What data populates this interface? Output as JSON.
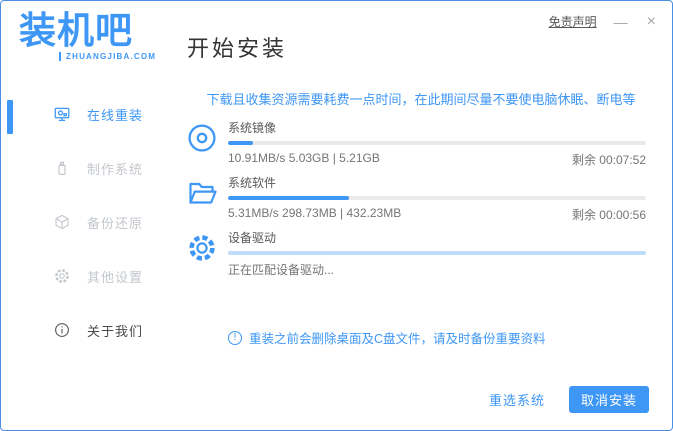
{
  "window": {
    "brand": "装机吧",
    "brand_domain": "ZHUANGJIBA.COM",
    "page_title": "开始安装",
    "disclaimer_link": "免责声明",
    "minimize_glyph": "—",
    "close_glyph": "×"
  },
  "sidebar": {
    "items": [
      {
        "label": "在线重装",
        "icon": "online-reinstall-monitor-icon",
        "state": "active"
      },
      {
        "label": "制作系统",
        "icon": "make-system-usb-icon",
        "state": "disabled"
      },
      {
        "label": "备份还原",
        "icon": "backup-restore-box-icon",
        "state": "disabled"
      },
      {
        "label": "其他设置",
        "icon": "other-settings-gear-icon",
        "state": "disabled"
      },
      {
        "label": "关于我们",
        "icon": "about-us-info-icon",
        "state": "normal"
      }
    ]
  },
  "main": {
    "top_notice": "下载且收集资源需要耗费一点时间，在此期间尽量不要使电脑休眠、断电等",
    "tasks": [
      {
        "icon": "disc-icon",
        "label": "系统镜像",
        "progress_percent": 6,
        "fill_color": "#3E97F5",
        "stats": "10.91MB/s 5.03GB | 5.21GB",
        "remaining": "剩余 00:07:52"
      },
      {
        "icon": "folder-icon",
        "label": "系统软件",
        "progress_percent": 29,
        "fill_color": "#3E97F5",
        "stats": "5.31MB/s 298.73MB | 432.23MB",
        "remaining": "剩余 00:00:56"
      },
      {
        "icon": "gear-icon",
        "label": "设备驱动",
        "progress_percent": 100,
        "fill_color": "#BFDCF8",
        "stats": "正在匹配设备驱动...",
        "remaining": ""
      }
    ],
    "bottom_notice": "重装之前会删除桌面及C盘文件，请及时备份重要资料",
    "bottom_notice_glyph": "!",
    "footer": {
      "reselect_button": "重选系统",
      "cancel_button": "取消安装"
    }
  },
  "colors": {
    "accent": "#3E97F5",
    "track": "#EAEAEA",
    "light_fill": "#BFDCF8",
    "window_border": "#4A90E2"
  }
}
